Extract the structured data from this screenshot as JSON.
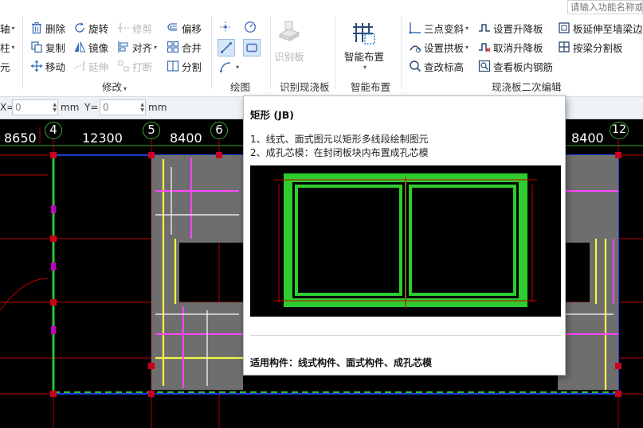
{
  "ribbon": {
    "left_partial": [
      "轴",
      "柱",
      "元"
    ],
    "modify": {
      "delete": "删除",
      "rotate": "旋转",
      "trim": "修剪",
      "offset": "偏移",
      "copy": "复制",
      "mirror": "镜像",
      "align": "对齐",
      "merge": "合并",
      "move": "移动",
      "extend": "延伸",
      "break": "打断",
      "split": "分割",
      "title": "修改"
    },
    "draw_title": "绘图",
    "identify": {
      "label": "识别板",
      "title": "识别现浇板"
    },
    "smart": {
      "label": "智能布置",
      "title": "智能布置"
    },
    "cast": {
      "three_point_slope": "三点变斜",
      "set_raise": "设置升降板",
      "extend_to_wall": "板延伸至墙梁边",
      "set_arch": "设置拱板",
      "cancel_raise": "取消升降板",
      "split_by_beam": "按梁分割板",
      "check_elev": "查改标高",
      "view_rebar": "查看板内钢筋",
      "title": "现浇板二次编辑"
    },
    "search_placeholder": "请输入功能名称或"
  },
  "coord": {
    "x_label": "X=",
    "x_value": "0",
    "x_unit": "mm",
    "y_label": "Y=",
    "y_value": "0",
    "y_unit": "mm"
  },
  "axis": {
    "dims": [
      "8650",
      "12300",
      "8400",
      "8400"
    ],
    "bubbles": [
      "4",
      "5",
      "6",
      "12"
    ]
  },
  "tooltip": {
    "title": "矩形 (JB)",
    "line1": "1、线式、面式图元以矩形多线段绘制图元",
    "line2": "2、成孔芯模：在封闭板块内布置成孔芯模",
    "footer": "适用构件：线式构件、面式构件、成孔芯模"
  }
}
